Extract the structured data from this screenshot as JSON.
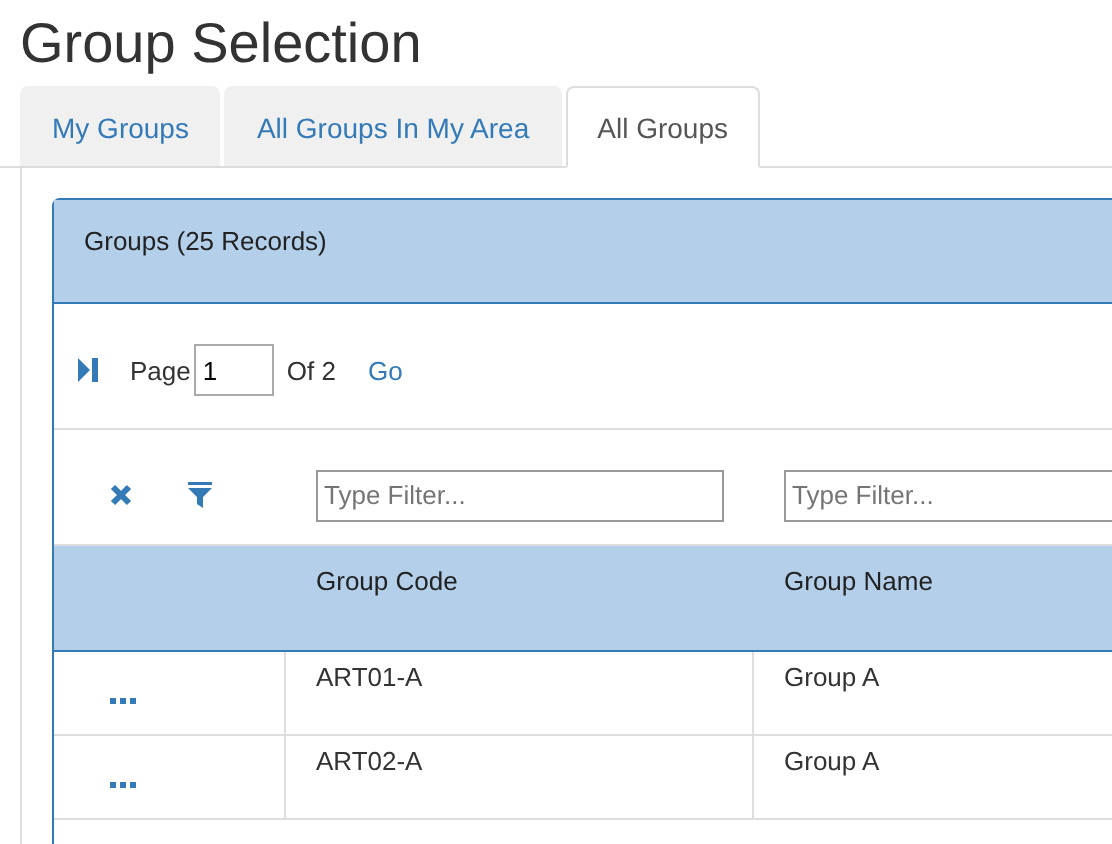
{
  "title": "Group Selection",
  "tabs": [
    {
      "label": "My Groups",
      "selected": false
    },
    {
      "label": "All Groups In My Area",
      "selected": false
    },
    {
      "label": "All Groups",
      "selected": true
    }
  ],
  "panel": {
    "heading": "Groups (25 Records)"
  },
  "pager": {
    "page_label": "Page",
    "page_value": "1",
    "of_label": "Of 2",
    "go": "Go"
  },
  "filters": [
    {
      "placeholder": "Type Filter..."
    },
    {
      "placeholder": "Type Filter..."
    }
  ],
  "table": {
    "columns": [
      "Group Code",
      "Group Name"
    ],
    "rows": [
      [
        "ART01-A",
        "Group A"
      ],
      [
        "ART02-A",
        "Group A"
      ]
    ]
  }
}
